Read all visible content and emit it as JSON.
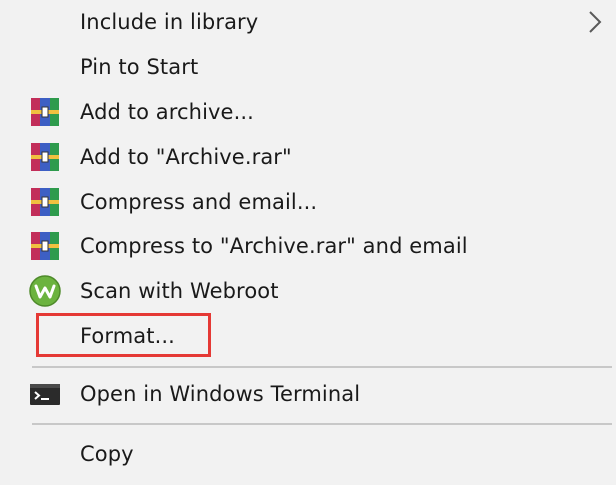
{
  "context_menu": {
    "items": [
      {
        "label": "Include in library",
        "icon": "none",
        "has_submenu": true
      },
      {
        "label": "Pin to Start",
        "icon": "none"
      },
      {
        "label": "Add to archive...",
        "icon": "winrar-icon"
      },
      {
        "label": "Add to \"Archive.rar\"",
        "icon": "winrar-icon"
      },
      {
        "label": "Compress and email...",
        "icon": "winrar-icon"
      },
      {
        "label": "Compress to \"Archive.rar\" and email",
        "icon": "winrar-icon"
      },
      {
        "label": "Scan with Webroot",
        "icon": "webroot-icon"
      },
      {
        "label": "Format...",
        "icon": "none",
        "highlighted": true
      },
      {
        "label": "Open in Windows Terminal",
        "icon": "terminal-icon"
      },
      {
        "label": "Copy",
        "icon": "none"
      }
    ]
  },
  "colors": {
    "menu_background": "#f2f2f2",
    "text": "#1a1a1a",
    "separator": "#c8c8c8",
    "highlight_border": "#e53935"
  }
}
